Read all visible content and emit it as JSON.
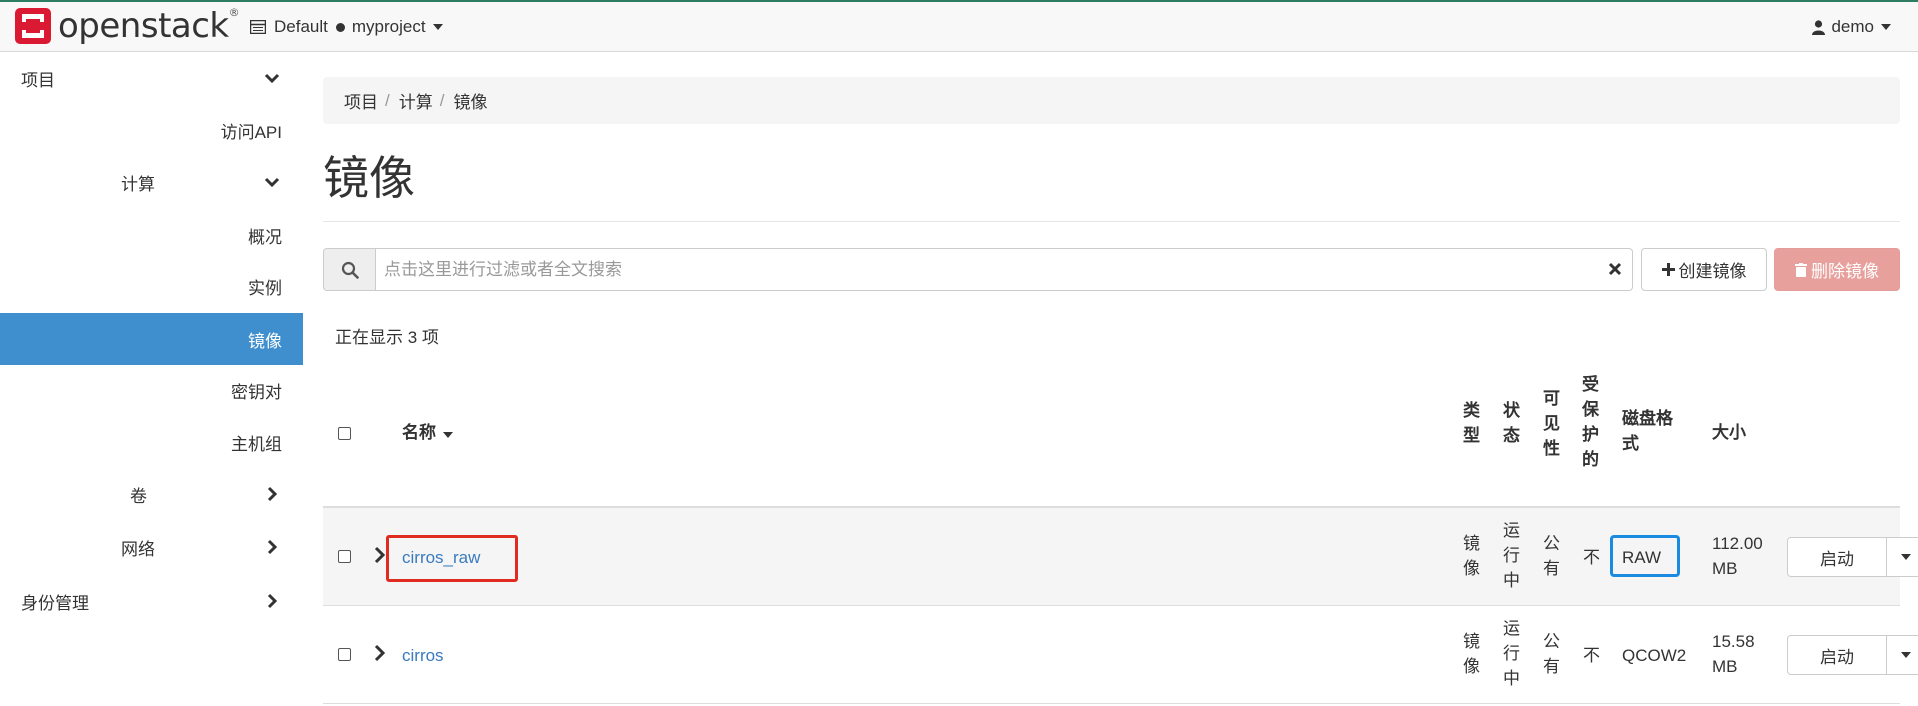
{
  "header": {
    "brand": "openstack",
    "brand_mark": "®",
    "domain": "Default",
    "project": "myproject",
    "user": "demo"
  },
  "sidebar": {
    "items": [
      {
        "label": "项目",
        "chevron": "chevron-down"
      },
      {
        "label": "访问API"
      },
      {
        "label": "计算",
        "chevron": "chevron-down"
      },
      {
        "label": "概况"
      },
      {
        "label": "实例"
      },
      {
        "label": "镜像",
        "active": true
      },
      {
        "label": "密钥对"
      },
      {
        "label": "主机组"
      },
      {
        "label": "卷",
        "chevron": "chevron-right"
      },
      {
        "label": "网络",
        "chevron": "chevron-right"
      },
      {
        "label": "身份管理",
        "chevron": "chevron-right"
      }
    ]
  },
  "breadcrumb": [
    "项目",
    "计算",
    "镜像"
  ],
  "breadcrumb_sep": "/",
  "page_title": "镜像",
  "search": {
    "placeholder": "点击这里进行过滤或者全文搜索",
    "icon": "search-icon",
    "clear_icon": "times-icon"
  },
  "actions": {
    "create_label": "创建镜像",
    "delete_label": "删除镜像"
  },
  "count_text": "正在显示 3 项",
  "table": {
    "headers": {
      "name": "名称",
      "type": "类型",
      "status": "状态",
      "visibility": "可见性",
      "protected": "受保护的",
      "disk_format": "磁盘格式",
      "size": "大小"
    },
    "rows": [
      {
        "name": "cirros_raw",
        "type": "镜像",
        "status": "运行中",
        "visibility": "公有",
        "protected": "不",
        "disk_format": "RAW",
        "size": "112.00 MB",
        "action": "启动"
      },
      {
        "name": "cirros",
        "type": "镜像",
        "status": "运行中",
        "visibility": "公有",
        "protected": "不",
        "disk_format": "QCOW2",
        "size": "15.58 MB",
        "action": "启动"
      }
    ]
  },
  "colors": {
    "brand_red": "#da1a32",
    "active_blue": "#3f8fce",
    "link_blue": "#3a7bbf",
    "delete_btn": "#e8a09d",
    "highlight_red": "#e02b20",
    "highlight_blue": "#1a8be0"
  }
}
